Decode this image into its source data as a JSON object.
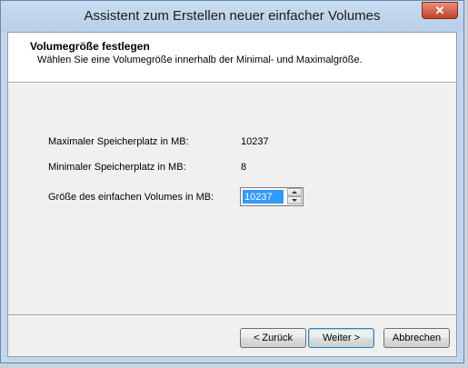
{
  "window": {
    "title": "Assistent zum Erstellen neuer einfacher Volumes"
  },
  "header": {
    "title": "Volumegröße festlegen",
    "subtitle": "Wählen Sie eine Volumegröße innerhalb der Minimal- und Maximalgröße."
  },
  "fields": {
    "max_label": "Maximaler Speicherplatz in MB:",
    "max_value": "10237",
    "min_label": "Minimaler Speicherplatz in MB:",
    "min_value": "8",
    "size_label": "Größe des einfachen Volumes in MB:",
    "size_value": "10237"
  },
  "buttons": {
    "back": "< Zurück",
    "next": "Weiter >",
    "cancel": "Abbrechen"
  },
  "icons": {
    "close": "close-icon",
    "spin_up": "arrow-up-icon",
    "spin_down": "arrow-down-icon"
  },
  "colors": {
    "selection": "#3399ff",
    "close_button": "#c5412a"
  }
}
